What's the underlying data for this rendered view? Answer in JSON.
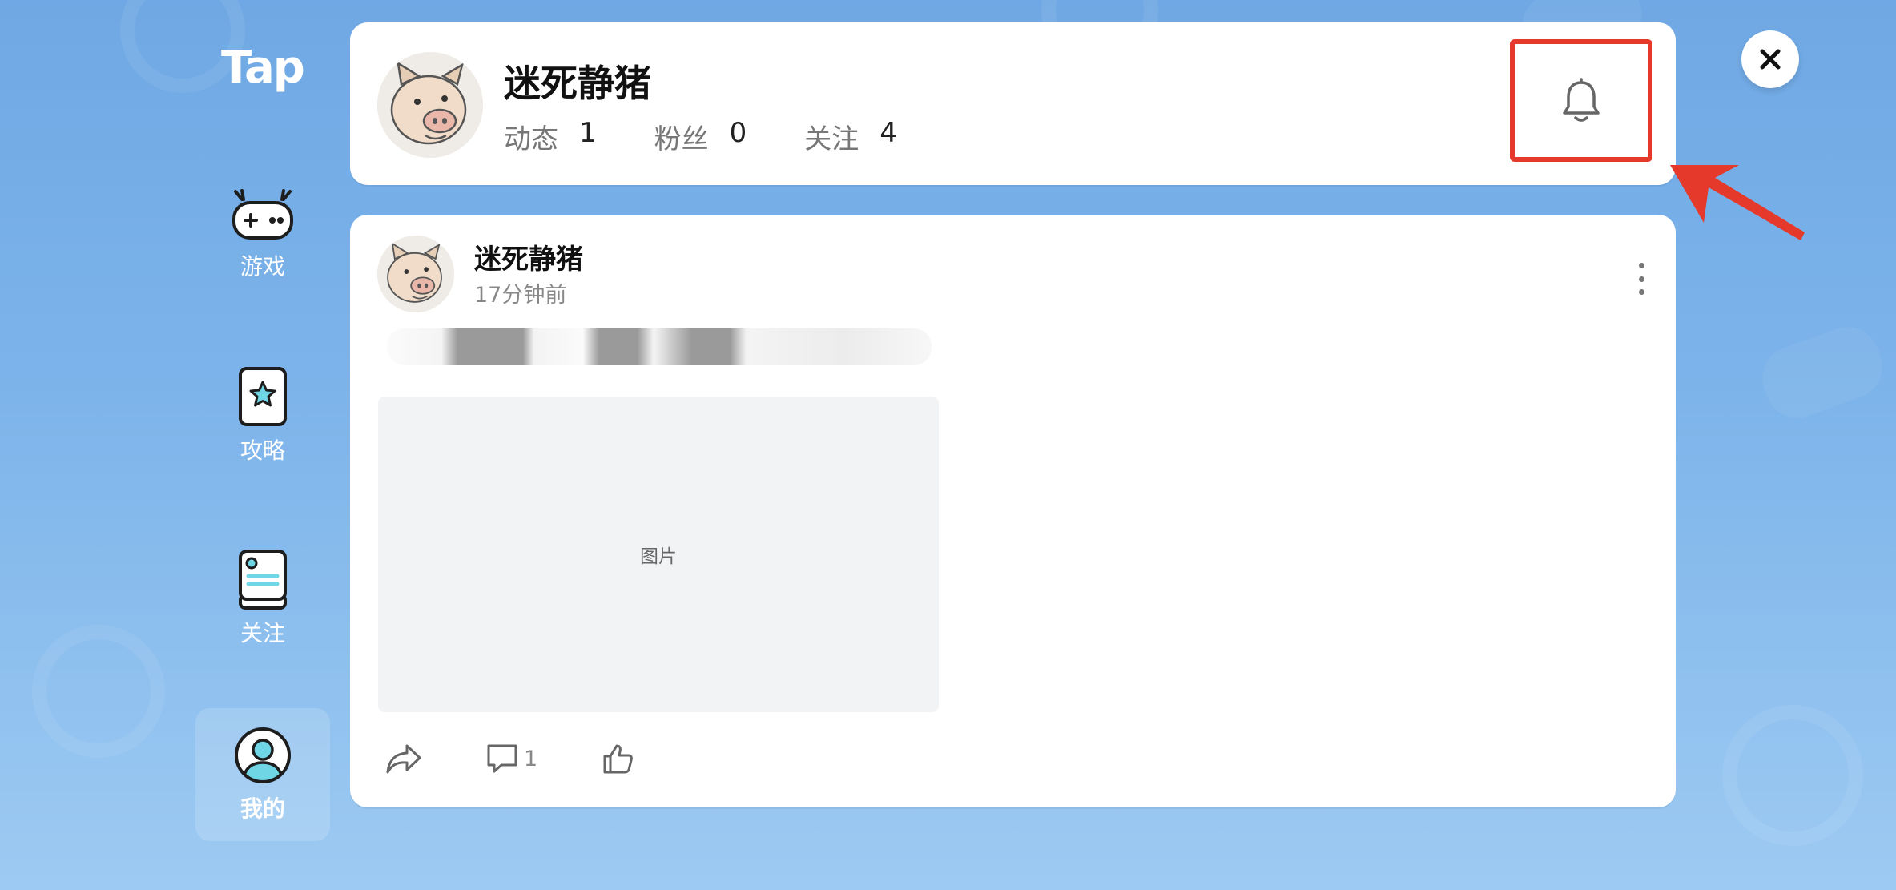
{
  "sidebar": {
    "logo": "Tap",
    "items": [
      {
        "label": "游戏",
        "icon": "gamepad-icon"
      },
      {
        "label": "攻略",
        "icon": "star-card-icon"
      },
      {
        "label": "关注",
        "icon": "feed-icon"
      },
      {
        "label": "我的",
        "icon": "user-icon",
        "active": true
      }
    ]
  },
  "profile": {
    "name": "迷死静猪",
    "stats": [
      {
        "label": "动态",
        "value": "1"
      },
      {
        "label": "粉丝",
        "value": "0"
      },
      {
        "label": "关注",
        "value": "4"
      }
    ],
    "bell_icon": "bell-icon",
    "highlight_color": "#e53a2b"
  },
  "close_icon": "close-icon",
  "post": {
    "author": "迷死静猪",
    "time": "17分钟前",
    "image_label": "图片",
    "comment_count": "1",
    "icons": [
      "share-icon",
      "comment-icon",
      "like-icon",
      "more-icon"
    ]
  },
  "colors": {
    "background": "#7db4ea",
    "accent": "#e53a2b"
  }
}
